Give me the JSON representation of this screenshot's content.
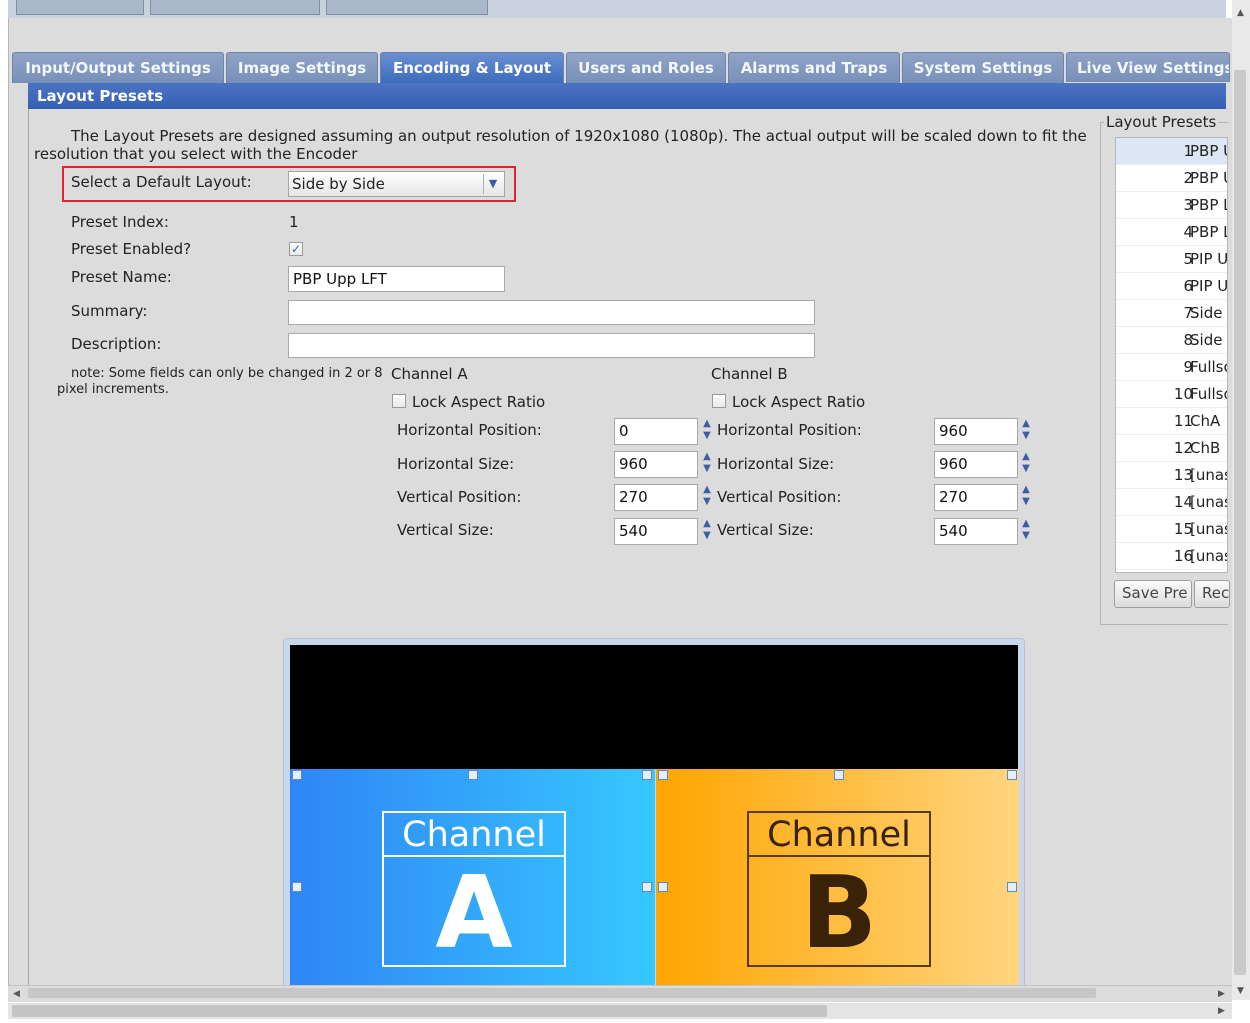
{
  "tabs": [
    {
      "label": "Input/Output Settings",
      "active": false
    },
    {
      "label": "Image Settings",
      "active": false
    },
    {
      "label": "Encoding & Layout",
      "active": true
    },
    {
      "label": "Users and Roles",
      "active": false
    },
    {
      "label": "Alarms and Traps",
      "active": false
    },
    {
      "label": "System Settings",
      "active": false
    },
    {
      "label": "Live View Settings",
      "active": false
    }
  ],
  "section_title": "Layout Presets",
  "intro": "The Layout Presets are designed assuming an output resolution of 1920x1080 (1080p). The actual output will be scaled down to fit the resolution that you select with the Encoder",
  "form": {
    "default_layout_label": "Select a Default Layout:",
    "default_layout_value": "Side by Side",
    "preset_index_label": "Preset Index:",
    "preset_index_value": "1",
    "preset_enabled_label": "Preset Enabled?",
    "preset_enabled": true,
    "preset_name_label": "Preset Name:",
    "preset_name_value": "PBP Upp LFT",
    "summary_label": "Summary:",
    "summary_value": "",
    "description_label": "Description:",
    "description_value": "",
    "note": "note: Some fields can only be changed in 2 or 8 pixel increments."
  },
  "channel_a": {
    "title": "Channel A",
    "lock_label": "Lock Aspect Ratio",
    "h_pos_label": "Horizontal Position:",
    "h_pos": "0",
    "h_size_label": "Horizontal Size:",
    "h_size": "960",
    "v_pos_label": "Vertical Position:",
    "v_pos": "270",
    "v_size_label": "Vertical Size:",
    "v_size": "540"
  },
  "channel_b": {
    "title": "Channel B",
    "lock_label": "Lock Aspect Ratio",
    "h_pos_label": "Horizontal Position:",
    "h_pos": "960",
    "h_size_label": "Horizontal Size:",
    "h_size": "960",
    "v_pos_label": "Vertical Position:",
    "v_pos": "270",
    "v_size_label": "Vertical Size:",
    "v_size": "540"
  },
  "presets_panel": {
    "title": "Layout Presets",
    "items": [
      {
        "num": "1",
        "name": "PBP U"
      },
      {
        "num": "2",
        "name": "PBP U"
      },
      {
        "num": "3",
        "name": "PBP L"
      },
      {
        "num": "4",
        "name": "PBP L"
      },
      {
        "num": "5",
        "name": "PIP U"
      },
      {
        "num": "6",
        "name": "PIP U"
      },
      {
        "num": "7",
        "name": "Side"
      },
      {
        "num": "8",
        "name": "Side"
      },
      {
        "num": "9",
        "name": "Fullsc"
      },
      {
        "num": "10",
        "name": "Fullsc"
      },
      {
        "num": "11",
        "name": "ChA"
      },
      {
        "num": "12",
        "name": "ChB"
      },
      {
        "num": "13",
        "name": "[unas"
      },
      {
        "num": "14",
        "name": "[unas"
      },
      {
        "num": "15",
        "name": "[unas"
      },
      {
        "num": "16",
        "name": "[unas"
      }
    ],
    "save_label": "Save Pre",
    "reset_label": "Rec"
  },
  "preview": {
    "a_word": "Channel",
    "a_letter": "A",
    "b_word": "Channel",
    "b_letter": "B"
  },
  "colors": {
    "accent": "#3d6bbd",
    "highlight": "#e0232e",
    "channel_a": "#2f85f5",
    "channel_b": "#ffa500"
  }
}
